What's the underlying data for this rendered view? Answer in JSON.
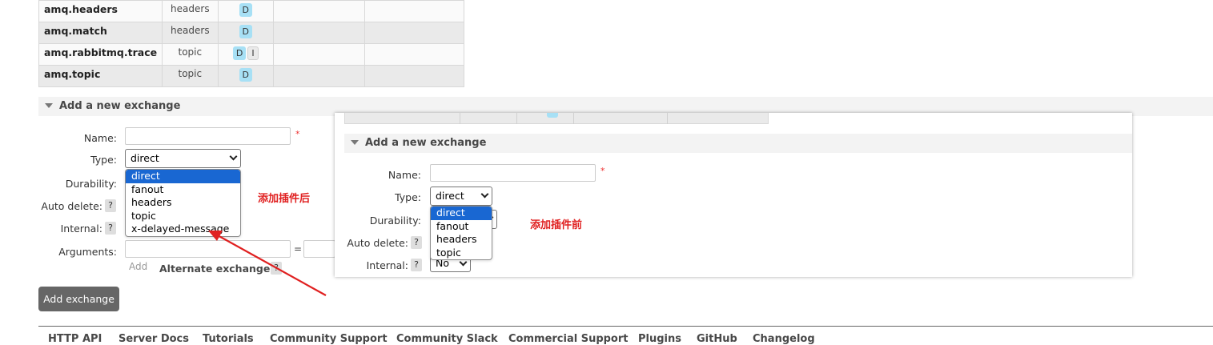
{
  "exchanges": [
    {
      "name": "amq.headers",
      "type": "headers",
      "features": [
        "D"
      ]
    },
    {
      "name": "amq.match",
      "type": "headers",
      "features": [
        "D"
      ]
    },
    {
      "name": "amq.rabbitmq.trace",
      "type": "topic",
      "features": [
        "D",
        "I"
      ]
    },
    {
      "name": "amq.topic",
      "type": "topic",
      "features": [
        "D"
      ]
    }
  ],
  "add_exchange": {
    "section_title": "Add a new exchange",
    "name_label": "Name:",
    "required_mark": "*",
    "type_label": "Type:",
    "type_selected": "direct",
    "type_options": [
      "direct",
      "fanout",
      "headers",
      "topic",
      "x-delayed-message"
    ],
    "durability_label": "Durability:",
    "auto_delete_label": "Auto delete:",
    "internal_label": "Internal:",
    "arguments_label": "Arguments:",
    "arguments_equals": "=",
    "help": "?",
    "add_link": "Add",
    "alternate_exchange_label": "Alternate exchange",
    "submit_label": "Add exchange"
  },
  "annotation_after": "添加插件后",
  "overlay": {
    "section_title": "Add a new exchange",
    "name_label": "Name:",
    "required_mark": "*",
    "type_label": "Type:",
    "type_selected": "direct",
    "type_options": [
      "direct",
      "fanout",
      "headers",
      "topic"
    ],
    "durability_label": "Durability:",
    "auto_delete_label": "Auto delete:",
    "internal_label": "Internal:",
    "internal_value": "No",
    "help": "?",
    "annotation_before": "添加插件前"
  },
  "colors": {
    "badge": "#a7e0f5",
    "selected_option": "#1967d2",
    "annotation": "#e02020",
    "button": "#666666"
  },
  "footer_links": [
    "HTTP API",
    "Server Docs",
    "Tutorials",
    "Community Support",
    "Community Slack",
    "Commercial Support",
    "Plugins",
    "GitHub",
    "Changelog"
  ]
}
